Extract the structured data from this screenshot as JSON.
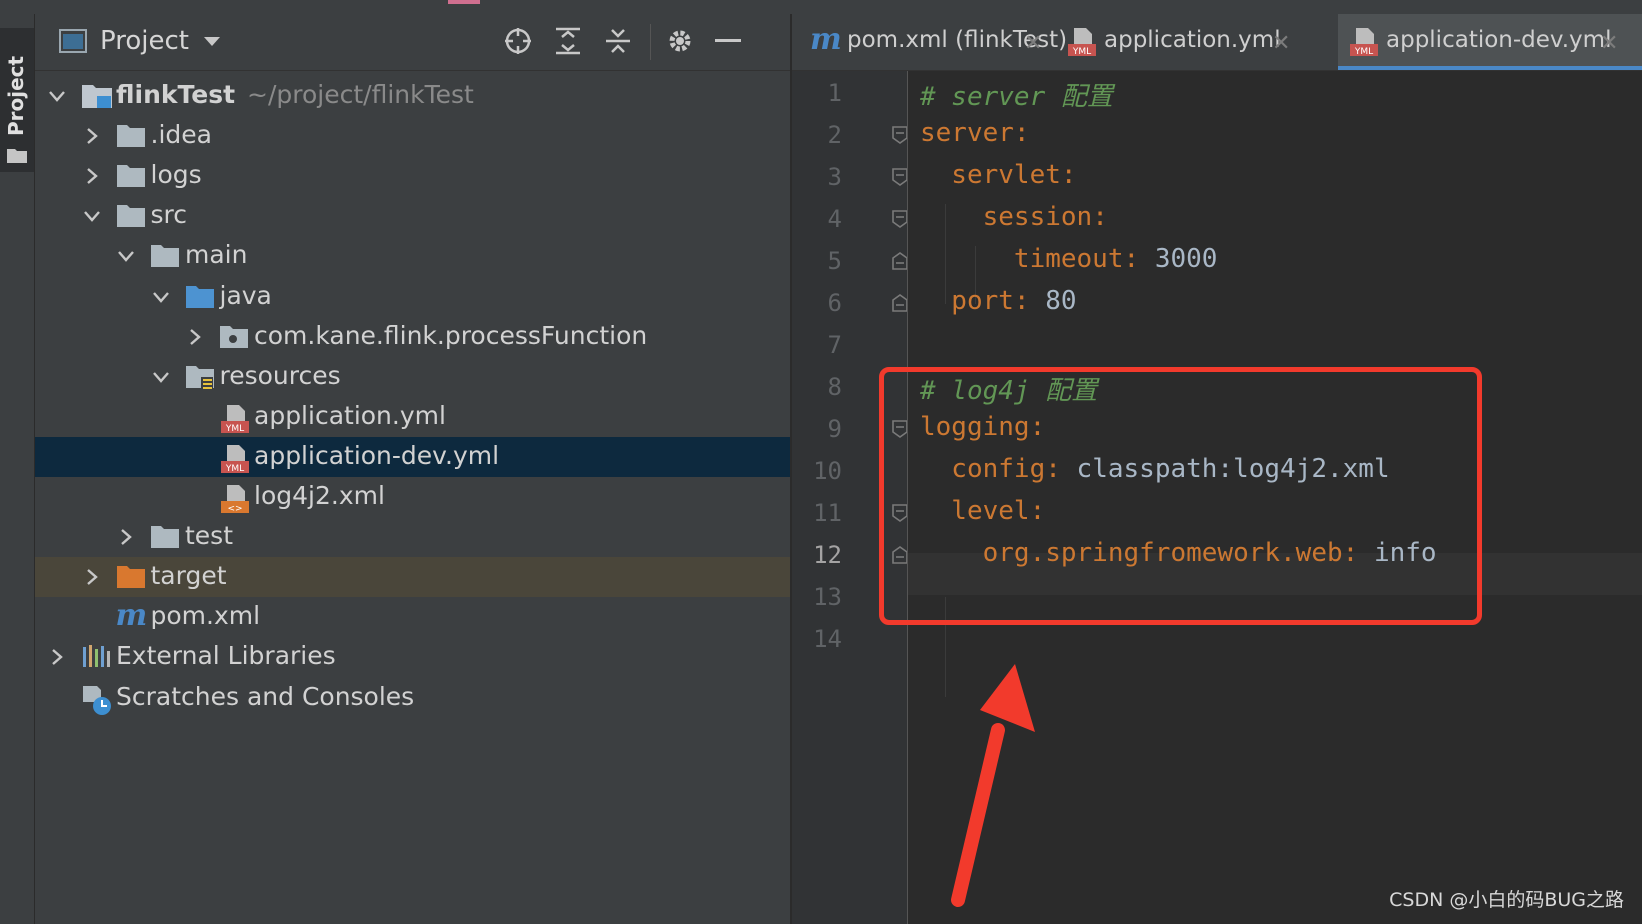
{
  "toolstrip": {
    "project_tab_label": "Project"
  },
  "project_panel": {
    "title": "Project",
    "tree": [
      {
        "label": "flinkTest",
        "path": "~/project/flinkTest",
        "kind": "module",
        "bold": true,
        "expanded": true
      },
      {
        "label": ".idea",
        "kind": "folder",
        "expanded": false
      },
      {
        "label": "logs",
        "kind": "folder",
        "expanded": false
      },
      {
        "label": "src",
        "kind": "folder",
        "expanded": true
      },
      {
        "label": "main",
        "kind": "folder",
        "expanded": true
      },
      {
        "label": "java",
        "kind": "folder-blue",
        "expanded": true
      },
      {
        "label": "com.kane.flink.processFunction",
        "kind": "package",
        "expanded": false
      },
      {
        "label": "resources",
        "kind": "folder-res",
        "expanded": true
      },
      {
        "label": "application.yml",
        "kind": "yml"
      },
      {
        "label": "application-dev.yml",
        "kind": "yml",
        "selected": true
      },
      {
        "label": "log4j2.xml",
        "kind": "xml"
      },
      {
        "label": "test",
        "kind": "folder",
        "expanded": false
      },
      {
        "label": "target",
        "kind": "folder-orange",
        "expanded": false
      },
      {
        "label": "pom.xml",
        "kind": "maven"
      },
      {
        "label": "External Libraries",
        "kind": "library",
        "expanded": false
      },
      {
        "label": "Scratches and Consoles",
        "kind": "scratch"
      }
    ]
  },
  "editor": {
    "tabs": [
      {
        "label": "pom.xml (flinkTest)",
        "icon": "maven-icon"
      },
      {
        "label": "application.yml",
        "icon": "yml-icon"
      },
      {
        "label": "application-dev.yml",
        "icon": "yml-icon",
        "active": true
      }
    ],
    "lines": [
      {
        "n": "1",
        "parts": [
          {
            "t": "# server 配置",
            "c": "comment"
          }
        ]
      },
      {
        "n": "2",
        "parts": [
          {
            "t": "server",
            "c": "key"
          },
          {
            "t": ":",
            "c": "punc"
          }
        ]
      },
      {
        "n": "3",
        "parts": [
          {
            "t": "  servlet",
            "c": "key"
          },
          {
            "t": ":",
            "c": "punc"
          }
        ]
      },
      {
        "n": "4",
        "parts": [
          {
            "t": "    session",
            "c": "key"
          },
          {
            "t": ":",
            "c": "punc"
          }
        ]
      },
      {
        "n": "5",
        "parts": [
          {
            "t": "      timeout",
            "c": "key"
          },
          {
            "t": ": ",
            "c": "punc"
          },
          {
            "t": "3000",
            "c": "val"
          }
        ]
      },
      {
        "n": "6",
        "parts": [
          {
            "t": "  port",
            "c": "key"
          },
          {
            "t": ": ",
            "c": "punc"
          },
          {
            "t": "80",
            "c": "val"
          }
        ]
      },
      {
        "n": "7",
        "parts": []
      },
      {
        "n": "8",
        "parts": [
          {
            "t": "# log4j 配置",
            "c": "comment"
          }
        ]
      },
      {
        "n": "9",
        "parts": [
          {
            "t": "logging",
            "c": "key"
          },
          {
            "t": ":",
            "c": "punc"
          }
        ]
      },
      {
        "n": "10",
        "parts": [
          {
            "t": "  config",
            "c": "key"
          },
          {
            "t": ": ",
            "c": "punc"
          },
          {
            "t": "classpath:log4j2.xml",
            "c": "val"
          }
        ]
      },
      {
        "n": "11",
        "parts": [
          {
            "t": "  level",
            "c": "key"
          },
          {
            "t": ":",
            "c": "punc"
          }
        ]
      },
      {
        "n": "12",
        "parts": [
          {
            "t": "    org.springfromework.web",
            "c": "key"
          },
          {
            "t": ": ",
            "c": "punc"
          },
          {
            "t": "info",
            "c": "val"
          }
        ]
      },
      {
        "n": "13",
        "parts": []
      },
      {
        "n": "14",
        "parts": []
      }
    ],
    "current_line": "12"
  },
  "colors": {
    "highlight_box": "#f23a2c",
    "selection": "#0d293e",
    "accent": "#4a88c7"
  },
  "watermark": "CSDN @小白的码BUG之路"
}
